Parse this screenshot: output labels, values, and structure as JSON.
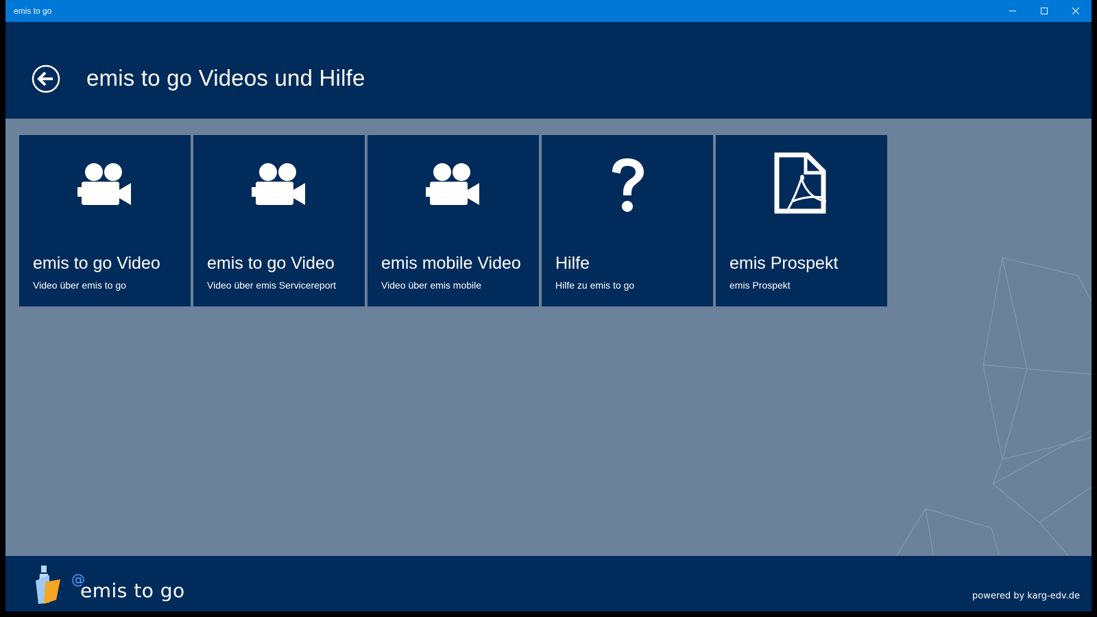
{
  "window": {
    "title": "emis to go",
    "controls": [
      "minimize-icon",
      "maximize-icon",
      "close-icon"
    ]
  },
  "header": {
    "back_icon": "back-arrow-icon",
    "title": "emis to go Videos und Hilfe"
  },
  "tiles": [
    {
      "icon": "video-camera-icon",
      "title": "emis to go Video",
      "subtitle": "Video über emis to go"
    },
    {
      "icon": "video-camera-icon",
      "title": "emis to go Video",
      "subtitle": "Video über emis Servicereport"
    },
    {
      "icon": "video-camera-icon",
      "title": "emis mobile Video",
      "subtitle": "Video über emis mobile"
    },
    {
      "icon": "question-mark-icon",
      "title": "Hilfe",
      "subtitle": "Hilfe zu emis to go"
    },
    {
      "icon": "pdf-document-icon",
      "title": "emis Prospekt",
      "subtitle": "emis Prospekt"
    }
  ],
  "footer": {
    "logo_at": "@",
    "logo_text": "emis to go",
    "powered_by": "powered by karg-edv.de"
  },
  "colors": {
    "titlebar": "#0078d7",
    "header": "#002b5b",
    "tile": "#002b5b",
    "background": "#6c819a",
    "logo_accent": "#f5a623"
  }
}
